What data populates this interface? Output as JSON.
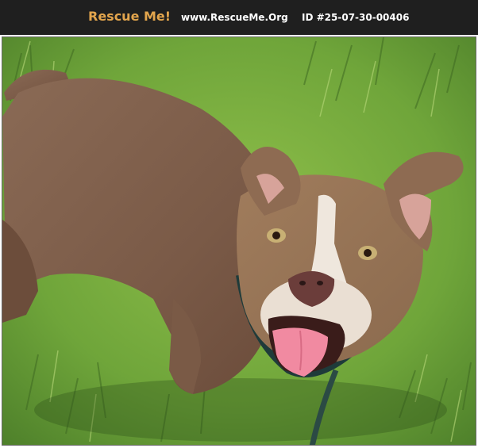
{
  "header": {
    "logo_text": "Rescue Me!",
    "site_url": "www.RescueMe.Org",
    "pet_id": "ID #25-07-30-00406"
  },
  "colors": {
    "banner_bg": "#1f1f1f",
    "logo": "#e2a54d",
    "text": "#ffffff"
  },
  "photo": {
    "subject": "dog",
    "background": "grass lawn"
  }
}
